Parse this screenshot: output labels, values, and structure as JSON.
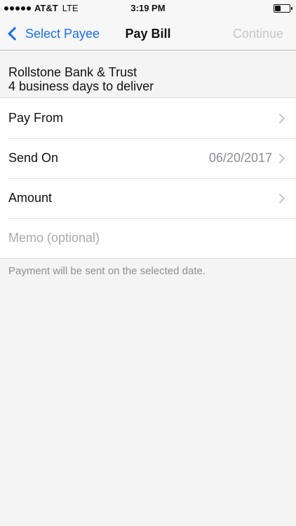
{
  "status_bar": {
    "carrier": "AT&T",
    "network": "LTE",
    "time": "3:19 PM",
    "battery_level": 0.35
  },
  "nav": {
    "back_label": "Select Payee",
    "title": "Pay Bill",
    "continue_label": "Continue"
  },
  "payee": {
    "name": "Rollstone Bank & Trust",
    "delivery": "4 business days to deliver"
  },
  "form": {
    "pay_from_label": "Pay From",
    "send_on_label": "Send On",
    "send_on_value": "06/20/2017",
    "amount_label": "Amount",
    "memo_placeholder": "Memo (optional)"
  },
  "note": "Payment will be sent on the selected date.",
  "colors": {
    "accent": "#1a6fe0",
    "disabled": "#c6c6c6",
    "secondary_text": "#8e8e93"
  }
}
